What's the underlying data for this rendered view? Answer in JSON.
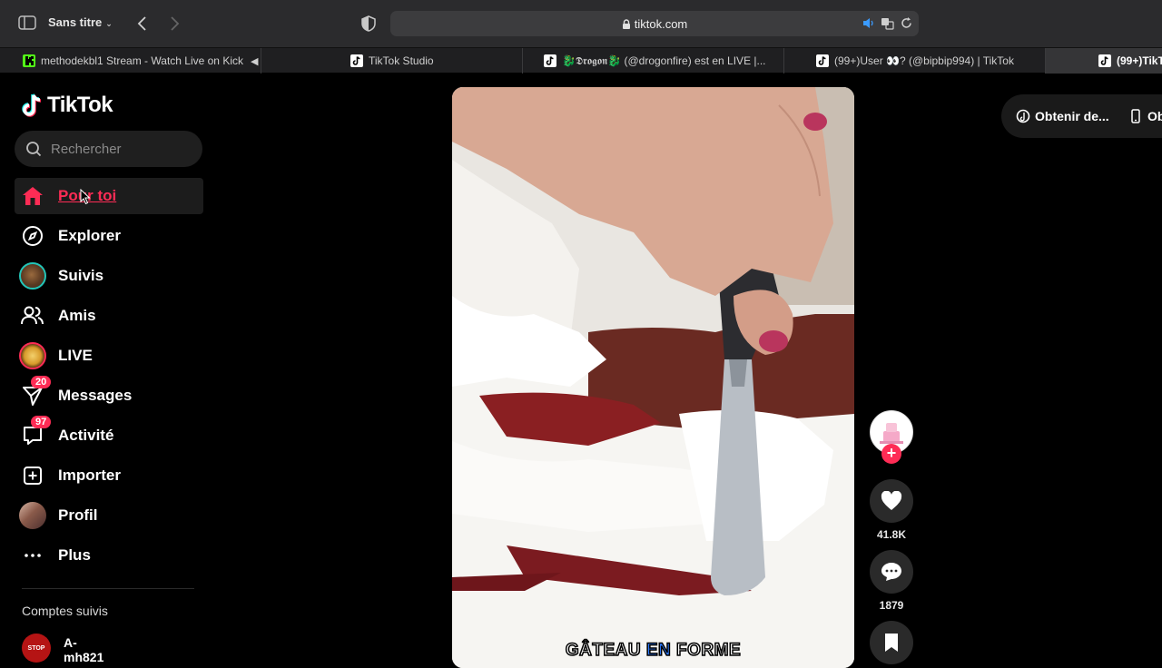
{
  "browser": {
    "window_title": "Sans titre",
    "url": "tiktok.com",
    "tabs": [
      {
        "label": "methodekbl1 Stream - Watch Live on Kick",
        "icon": "kick-icon"
      },
      {
        "label": "TikTok Studio",
        "icon": "tiktok-icon"
      },
      {
        "label": "🐉𝕯𝖗𝖔𝖌𝖔𝖓🐉 (@drogonfire) est en LIVE |...",
        "icon": "tiktok-icon"
      },
      {
        "label": "(99+)User 👀? (@bipbip994) | TikTok",
        "icon": "tiktok-icon"
      },
      {
        "label": "(99+)TikT",
        "icon": "tiktok-icon",
        "active": true
      }
    ]
  },
  "tiktok": {
    "logo": "TikTok",
    "search_placeholder": "Rechercher",
    "nav": [
      {
        "label": "Pour toi",
        "icon": "home-icon",
        "active": true
      },
      {
        "label": "Explorer",
        "icon": "compass-icon"
      },
      {
        "label": "Suivis",
        "icon": "following-avatar-icon"
      },
      {
        "label": "Amis",
        "icon": "friends-icon"
      },
      {
        "label": "LIVE",
        "icon": "live-icon"
      },
      {
        "label": "Messages",
        "icon": "messages-icon",
        "badge": "20"
      },
      {
        "label": "Activité",
        "icon": "activity-icon",
        "badge": "97"
      },
      {
        "label": "Importer",
        "icon": "upload-icon"
      },
      {
        "label": "Profil",
        "icon": "profile-avatar-icon"
      },
      {
        "label": "Plus",
        "icon": "more-icon"
      }
    ],
    "followed_title": "Comptes suivis",
    "followed": [
      {
        "name": "A-mh821",
        "avatar_text": "STOP"
      }
    ],
    "get_app": {
      "label1": "Obtenir de...",
      "label2": "Obt"
    }
  },
  "video": {
    "caption_pre": "GÂTEAU ",
    "caption_hl": "EN",
    "caption_post": " FORME",
    "likes": "41.8K",
    "comments": "1879"
  },
  "colors": {
    "accent": "#fe2c55",
    "caption_highlight": "#2e7bff"
  }
}
